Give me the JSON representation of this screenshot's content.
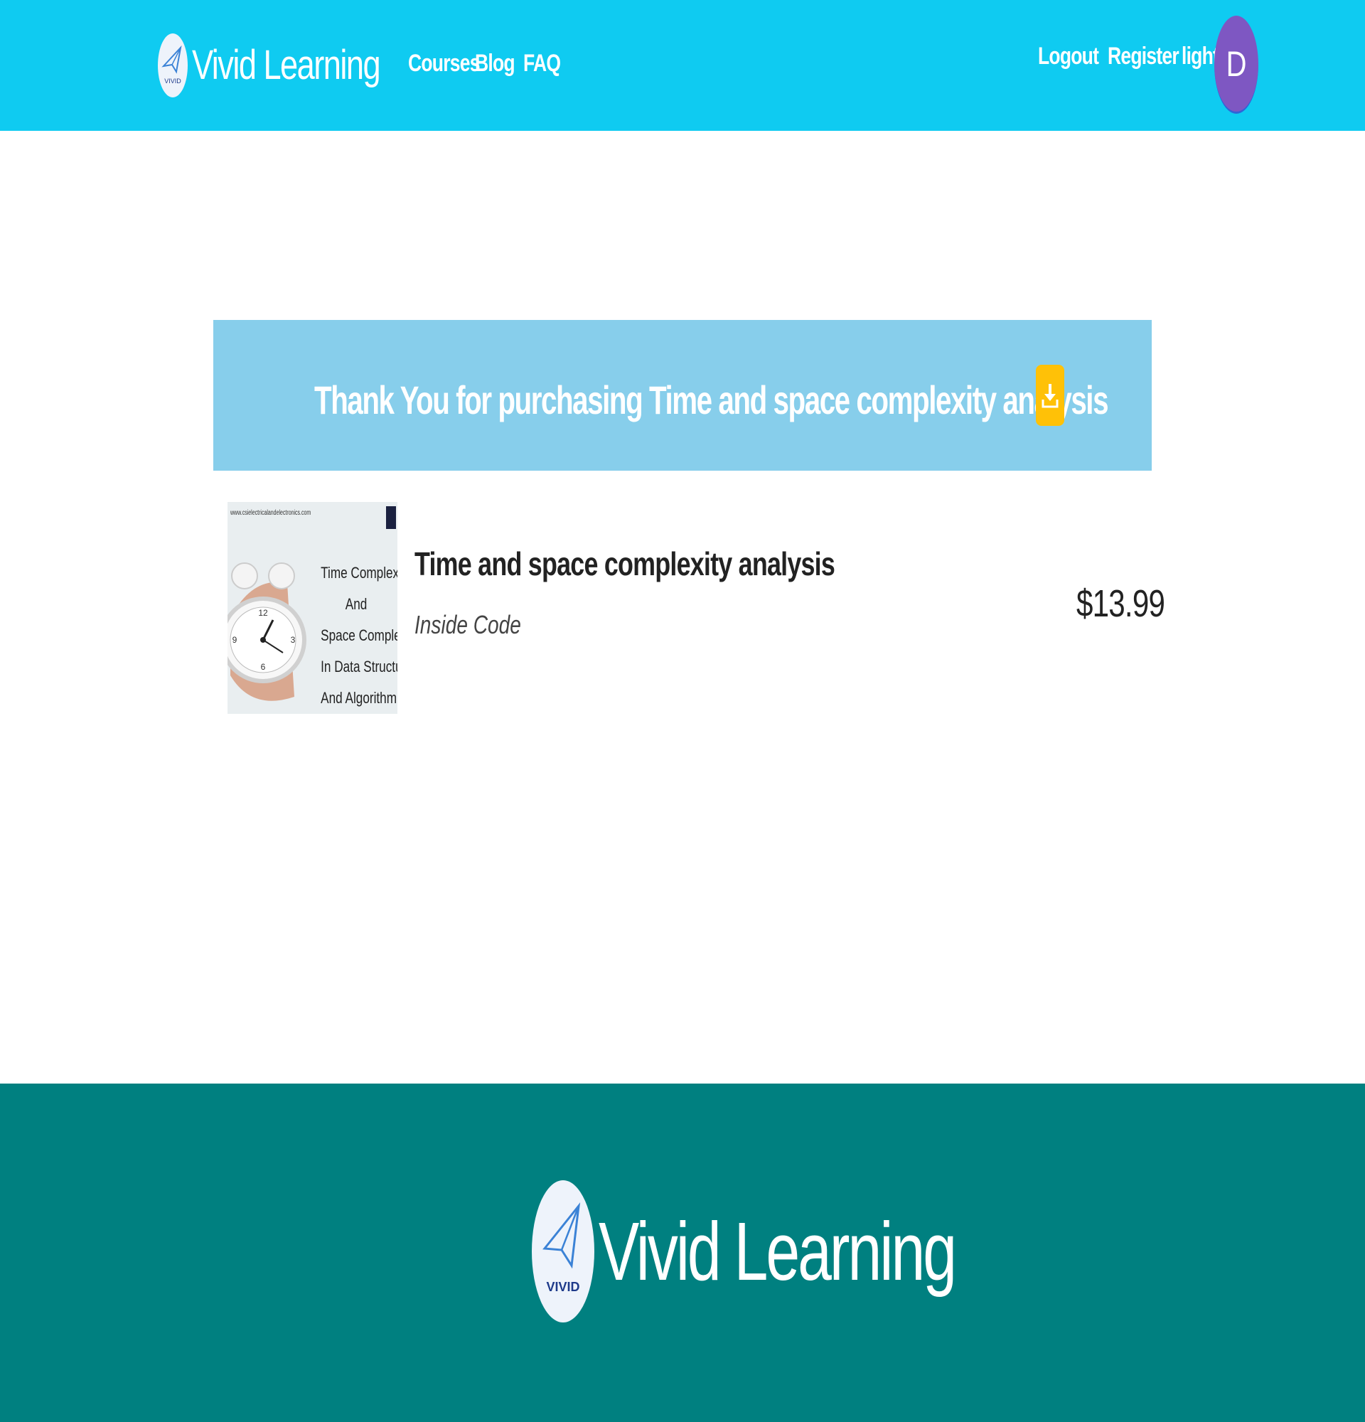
{
  "header": {
    "brand": "Vivid Learning",
    "logo_text": "VIVID",
    "nav": [
      "Courses",
      "Blog",
      "FAQ"
    ],
    "right_nav": [
      "Logout",
      "Register",
      "light"
    ],
    "avatar_initial": "D"
  },
  "banner": {
    "message": "Thank You for purchasing Time and space complexity analysis",
    "download_icon": "download-icon"
  },
  "purchase": {
    "thumbnail": {
      "site": "www.csielectricalandelectronics.com",
      "caption": [
        "Time Complexity",
        "And",
        "Space Complexity",
        "In Data Structures",
        "And Algorithm"
      ]
    },
    "title": "Time and space complexity analysis",
    "author": "Inside Code",
    "price": "$13.99"
  },
  "footer": {
    "brand": "Vivid Learning",
    "logo_text": "VIVID"
  },
  "colors": {
    "header_bg": "#0fcbf1",
    "banner_bg": "#87ceeb",
    "download_bg": "#ffc107",
    "avatar_bg": "#7e57c2",
    "footer_bg": "#008080"
  }
}
